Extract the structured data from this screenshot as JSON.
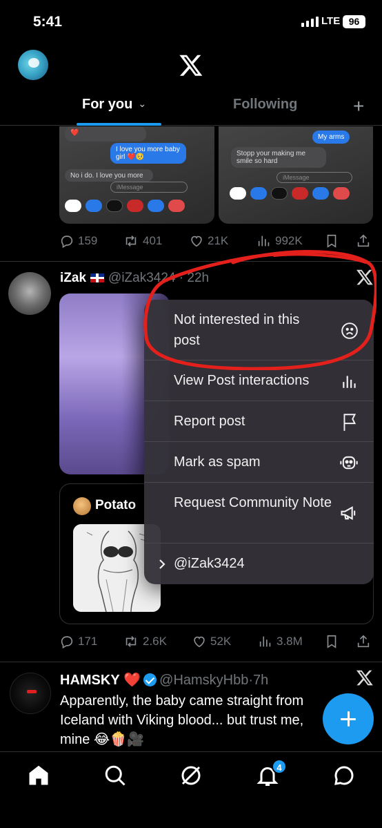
{
  "status_bar": {
    "time": "5:41",
    "network": "LTE",
    "battery": "96"
  },
  "header": {
    "tabs": [
      {
        "label": "For you"
      },
      {
        "label": "Following"
      }
    ]
  },
  "post1": {
    "image_left": {
      "gray_top": "❤️",
      "blue": "I love you more baby girl ❤️🥺",
      "gray_bottom": "No i do. I love you more",
      "imessage_placeholder": "iMessage"
    },
    "image_right": {
      "blue": "My arms",
      "gray": "Stopp your making me smile so hard",
      "imessage_placeholder": "iMessage"
    },
    "stats": {
      "replies": "159",
      "reposts": "401",
      "likes": "21K",
      "views": "992K"
    }
  },
  "post2": {
    "name": "iZak",
    "handle": "@iZak3424",
    "time": "22h",
    "quote": {
      "name": "Potato"
    },
    "stats": {
      "replies": "171",
      "reposts": "2.6K",
      "likes": "52K",
      "views": "3.8M"
    }
  },
  "menu": {
    "items": [
      {
        "label": "Not interested in this post",
        "icon": "frown-face-icon"
      },
      {
        "label": "View Post interactions",
        "icon": "bar-chart-icon"
      },
      {
        "label": "Report post",
        "icon": "flag-icon"
      },
      {
        "label": "Mark as spam",
        "icon": "robot-icon"
      },
      {
        "label": "Request Community Note",
        "icon": "megaphone-icon"
      },
      {
        "label": "@iZak3424",
        "icon": "chevron-right-icon"
      }
    ]
  },
  "post3": {
    "name": "HAMSKY",
    "heart": "❤️",
    "handle": "@HamskyHbb",
    "time": "7h",
    "text": "Apparently, the baby came straight from Iceland with Viking blood... but trust me, mine 😂🍿🎥"
  },
  "nav": {
    "notifications_badge": "4"
  },
  "colors": {
    "accent": "#1d9bf0",
    "annotation": "#e3201b",
    "background": "#000000"
  }
}
